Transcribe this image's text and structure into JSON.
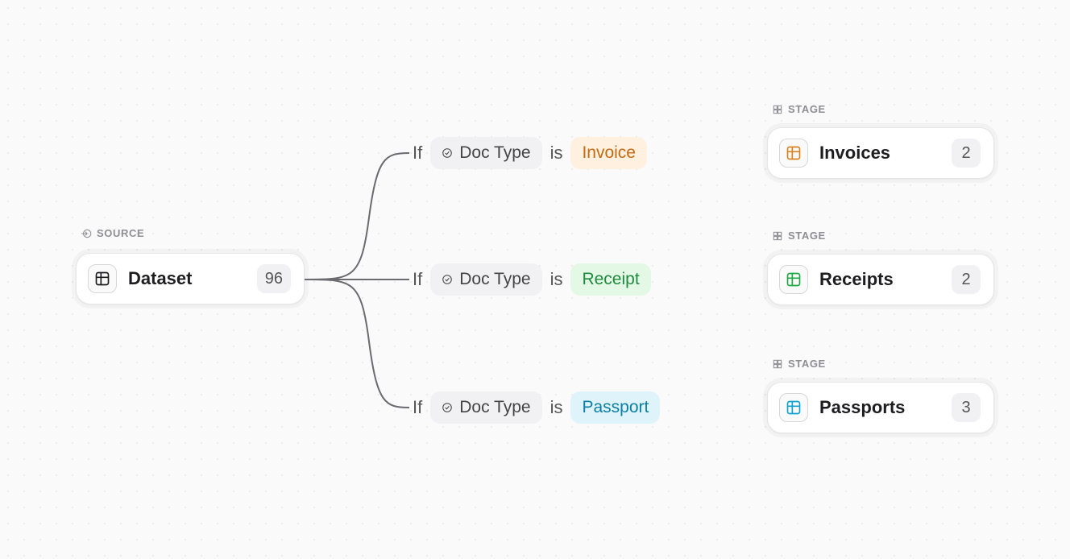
{
  "labels": {
    "source": "SOURCE",
    "stage": "STAGE",
    "if": "If",
    "is": "is"
  },
  "source": {
    "name": "Dataset",
    "count": "96"
  },
  "rules": [
    {
      "field": "Doc Type",
      "value": "Invoice",
      "value_class": "t-orange"
    },
    {
      "field": "Doc Type",
      "value": "Receipt",
      "value_class": "t-green"
    },
    {
      "field": "Doc Type",
      "value": "Passport",
      "value_class": "t-cyan"
    }
  ],
  "stages": [
    {
      "name": "Invoices",
      "count": "2",
      "color_class": "c-orange"
    },
    {
      "name": "Receipts",
      "count": "2",
      "color_class": "c-green"
    },
    {
      "name": "Passports",
      "count": "3",
      "color_class": "c-cyan"
    }
  ]
}
